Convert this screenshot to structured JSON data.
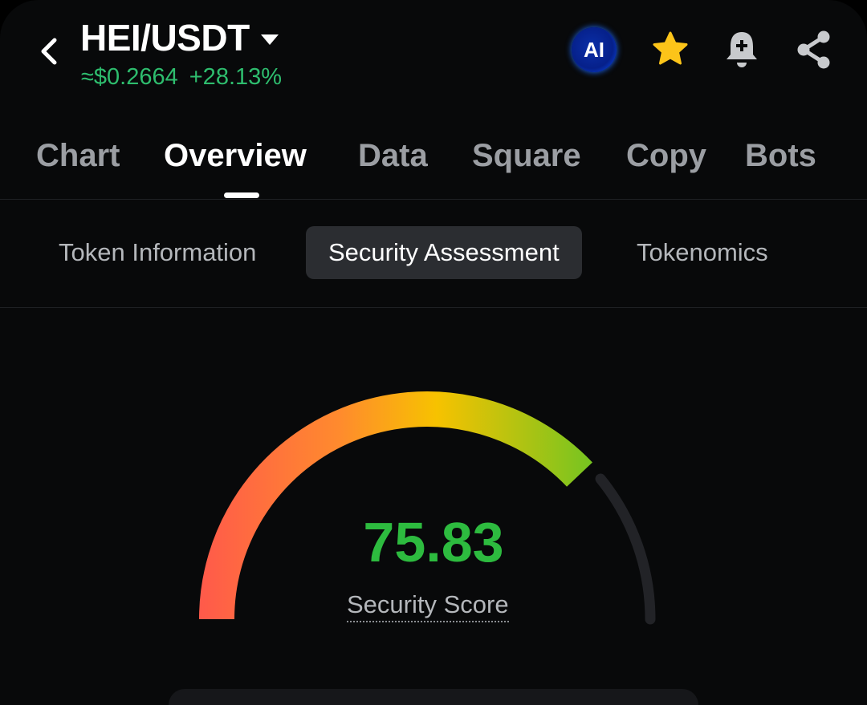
{
  "header": {
    "pair": "HEI/USDT",
    "price": "≈$0.2664",
    "change": "+28.13%",
    "ai_label": "AI"
  },
  "tabs": [
    {
      "label": "Chart"
    },
    {
      "label": "Overview"
    },
    {
      "label": "Data"
    },
    {
      "label": "Square"
    },
    {
      "label": "Copy"
    },
    {
      "label": "Bots"
    }
  ],
  "subtabs": [
    {
      "label": "Token Information"
    },
    {
      "label": "Security Assessment"
    },
    {
      "label": "Tokenomics"
    }
  ],
  "security": {
    "score": "75.83",
    "score_value": 75.83,
    "score_max": 100,
    "label": "Security Score"
  },
  "colors": {
    "positive": "#2ebd6e",
    "score": "#2dbb3f",
    "star": "#fcc419",
    "track": "#222327"
  }
}
